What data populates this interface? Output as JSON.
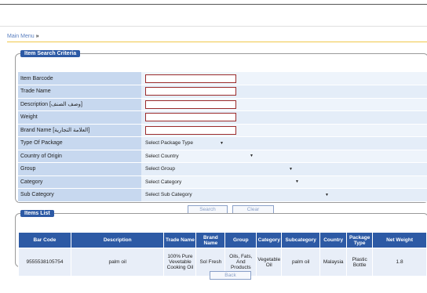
{
  "breadcrumb": {
    "label": "Main Menu",
    "sep": "»"
  },
  "criteria": {
    "legend": "Item Search Criteria",
    "fields": [
      {
        "label": "Item Barcode",
        "type": "text",
        "value": ""
      },
      {
        "label": "Trade Name",
        "type": "text",
        "value": ""
      },
      {
        "label": "Description [وصف الصنف]",
        "type": "text",
        "value": ""
      },
      {
        "label": "Weight",
        "type": "text",
        "value": ""
      },
      {
        "label": "Brand Name [العلامة التجارية]",
        "type": "text",
        "value": ""
      },
      {
        "label": "Type Of Package",
        "type": "select",
        "value": "Select Package Type"
      },
      {
        "label": "Country of Origin",
        "type": "select",
        "value": "Select Country"
      },
      {
        "label": "Group",
        "type": "select",
        "value": "Select Group"
      },
      {
        "label": "Category",
        "type": "select",
        "value": "Select Category"
      },
      {
        "label": "Sub Category",
        "type": "select",
        "value": "Select Sub Category"
      }
    ],
    "search_label": "Search",
    "clear_label": "Clear"
  },
  "items": {
    "legend": "Items List",
    "headers": [
      "Bar Code",
      "Description",
      "Trade Name",
      "Brand Name",
      "Group",
      "Category",
      "Subcategory",
      "Country",
      "Package Type",
      "Net Weight"
    ],
    "rows": [
      [
        "9555538105754",
        "palm oil",
        "100% Pure Vevetable Cooking Oil",
        "Sol Fresh",
        "Oils, Fats, And Products",
        "Vegetable Oil",
        "palm oil",
        "Malaysia",
        "Plastic Bottle",
        "1.8"
      ]
    ]
  },
  "back_label": "Back"
}
